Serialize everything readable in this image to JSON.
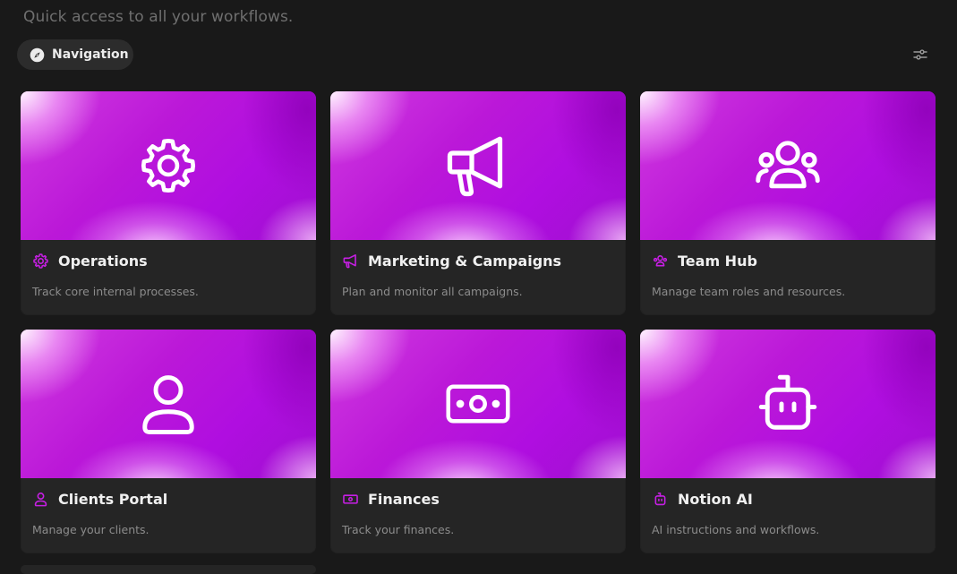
{
  "page": {
    "subtitle": "Quick access to all your workflows.",
    "accent_color": "#c61fe3",
    "background": "#191919"
  },
  "nav_pill": {
    "label": "Navigation",
    "icon": "compass-icon"
  },
  "toolbar": {
    "filter_icon": "sliders-icon"
  },
  "cards": [
    {
      "title": "Operations",
      "description": "Track core internal processes.",
      "icon": "gear-icon"
    },
    {
      "title": "Marketing & Campaigns",
      "description": "Plan and monitor all campaigns.",
      "icon": "megaphone-icon"
    },
    {
      "title": "Team Hub",
      "description": "Manage team roles and resources.",
      "icon": "team-icon"
    },
    {
      "title": "Clients Portal",
      "description": "Manage your clients.",
      "icon": "user-icon"
    },
    {
      "title": "Finances",
      "description": "Track your finances.",
      "icon": "banknote-icon"
    },
    {
      "title": "Notion AI",
      "description": "AI instructions and workflows.",
      "icon": "robot-icon"
    }
  ]
}
